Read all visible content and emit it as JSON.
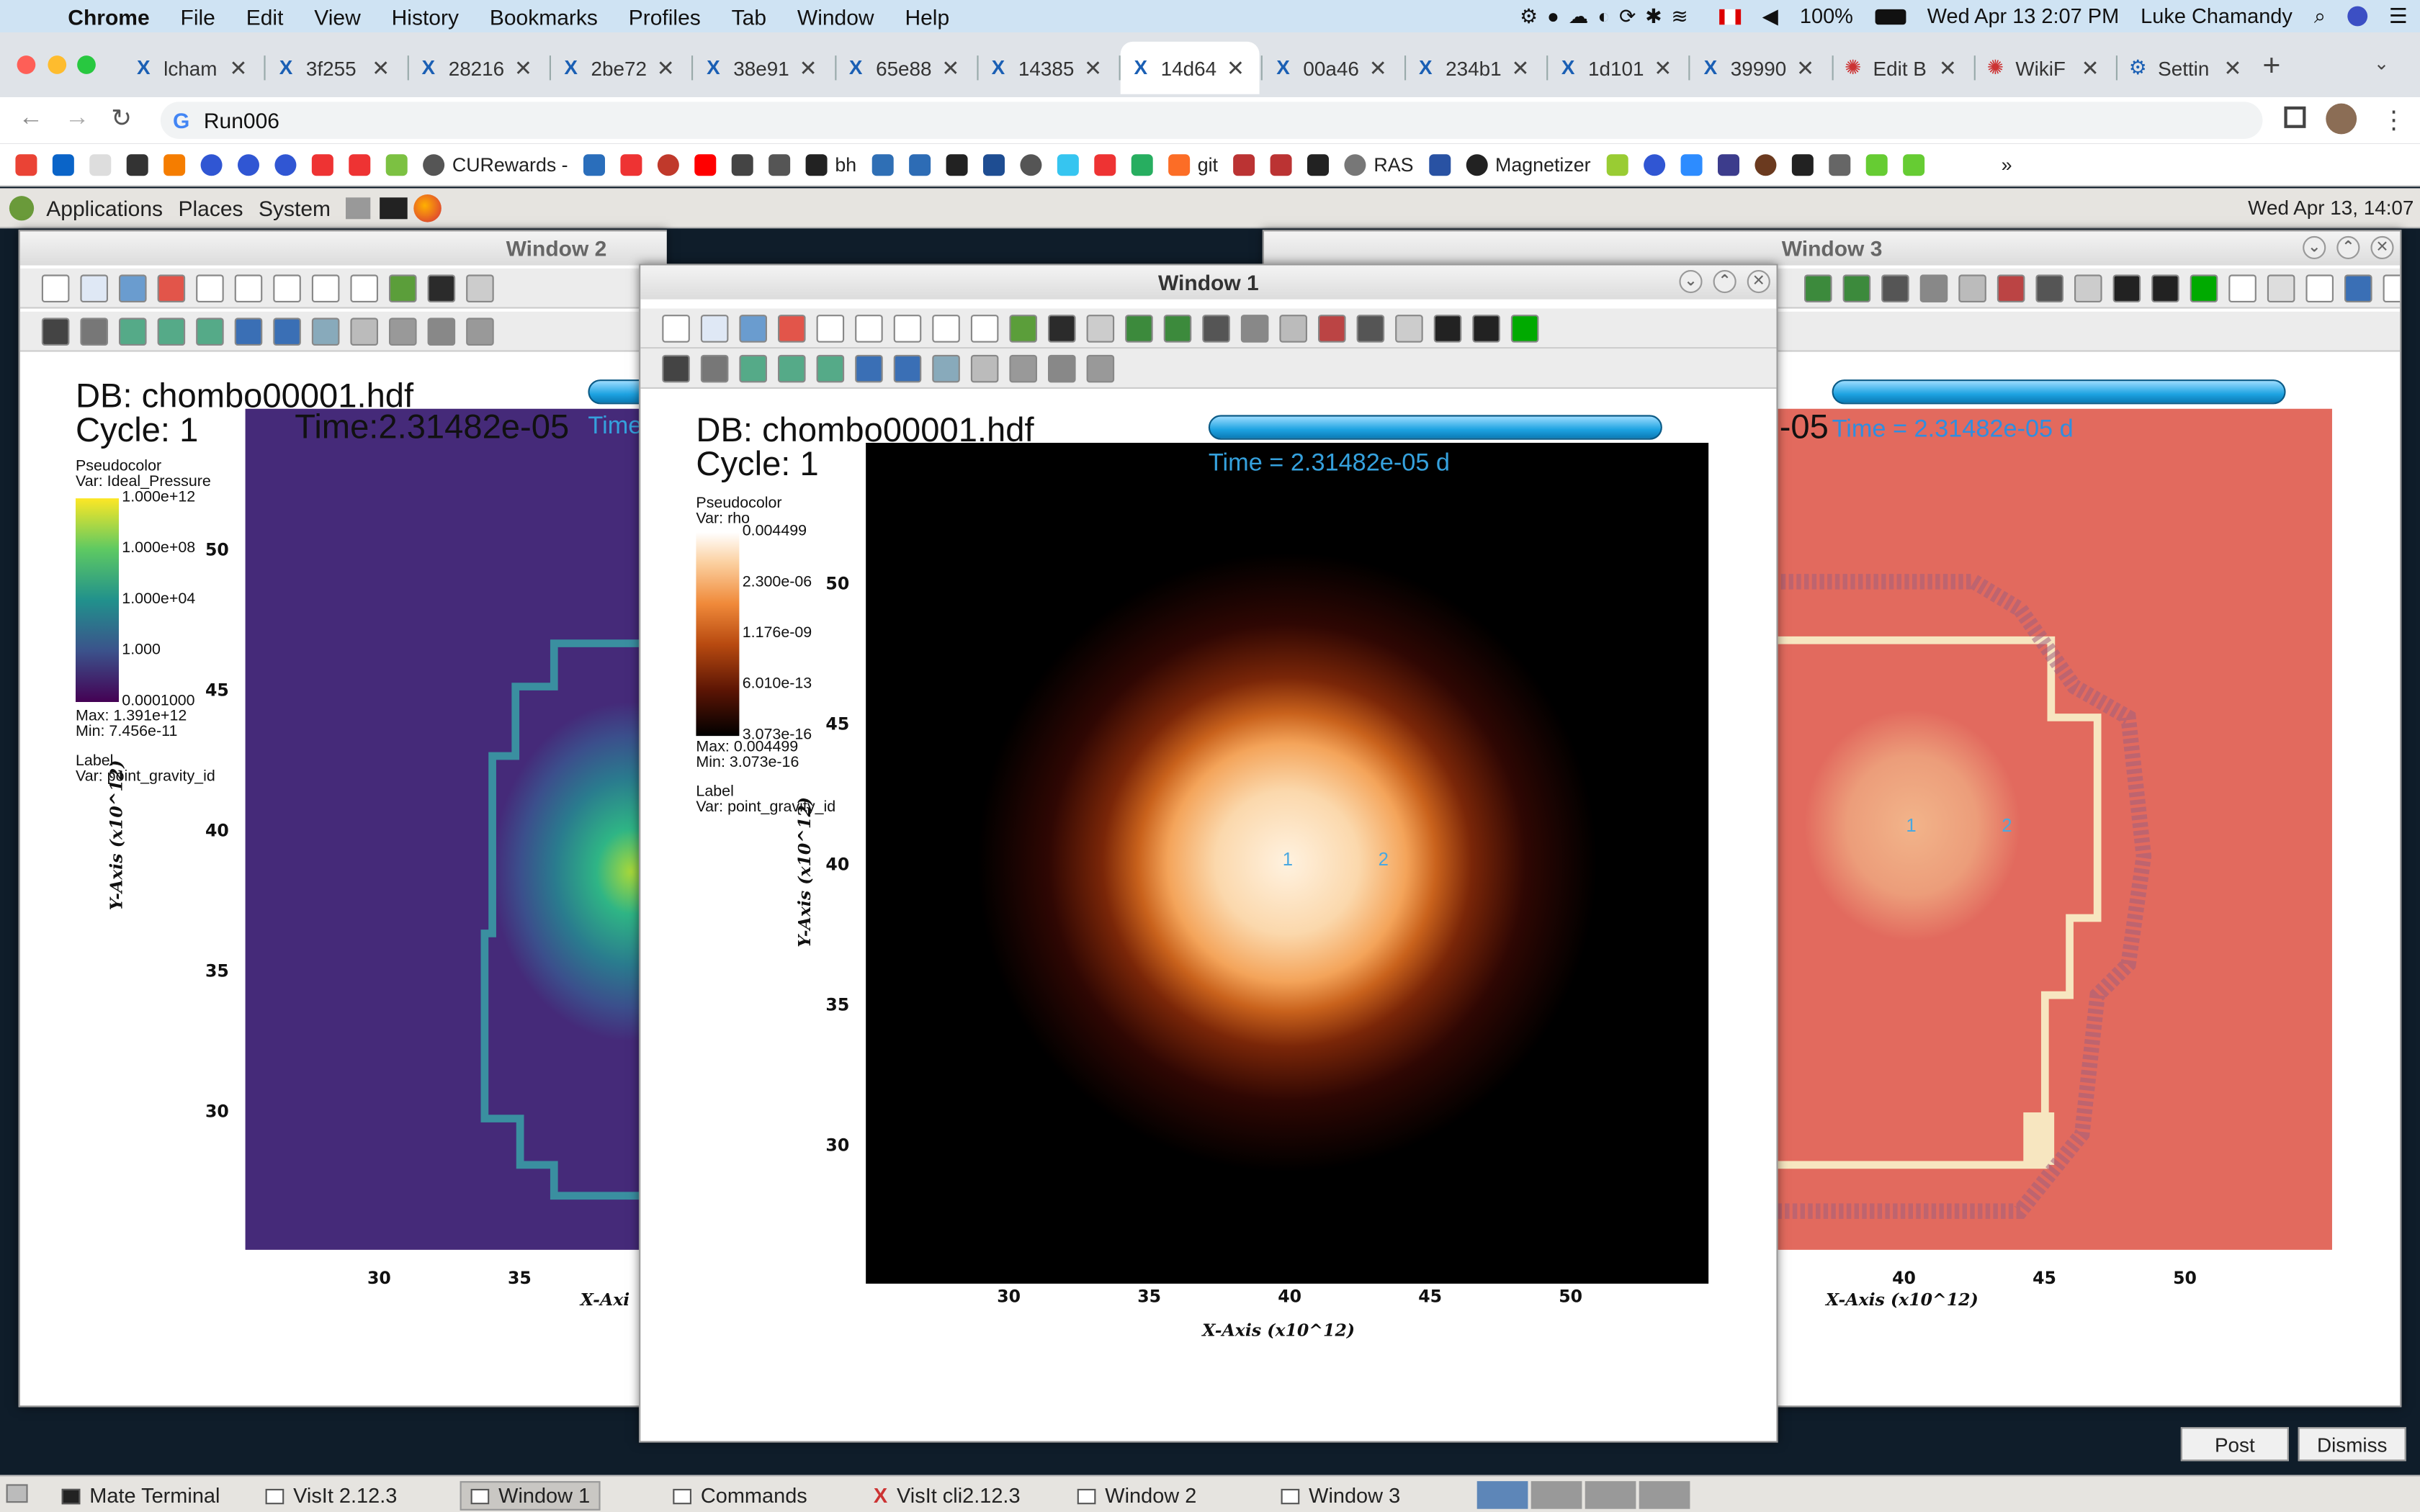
{
  "menubar": {
    "app": "Chrome",
    "items": [
      "File",
      "Edit",
      "View",
      "History",
      "Bookmarks",
      "Profiles",
      "Tab",
      "Window",
      "Help"
    ],
    "battery": "100%",
    "datetime": "Wed Apr 13  2:07 PM",
    "user": "Luke Chamandy"
  },
  "tabs": [
    {
      "label": "lcham",
      "active": false
    },
    {
      "label": "3f255",
      "active": false
    },
    {
      "label": "28216",
      "active": false
    },
    {
      "label": "2be72",
      "active": false
    },
    {
      "label": "38e91",
      "active": false
    },
    {
      "label": "65e88",
      "active": false
    },
    {
      "label": "14385",
      "active": false
    },
    {
      "label": "14d64",
      "active": true
    },
    {
      "label": "00a46",
      "active": false
    },
    {
      "label": "234b1",
      "active": false
    },
    {
      "label": "1d101",
      "active": false
    },
    {
      "label": "39990",
      "active": false
    },
    {
      "label": "Edit B",
      "active": false
    },
    {
      "label": "WikiF",
      "active": false
    },
    {
      "label": "Settin",
      "active": false
    }
  ],
  "address": {
    "url": "Run006"
  },
  "bookmarks": {
    "curewards": "CURewards -",
    "bh": "bh",
    "git": "git",
    "ras": "RAS",
    "magnetizer": "Magnetizer"
  },
  "gnome": {
    "applications": "Applications",
    "places": "Places",
    "system": "System",
    "clock": "Wed Apr 13, 14:07"
  },
  "taskbar": {
    "items": [
      "Mate Terminal",
      "VisIt 2.12.3",
      "Window 1",
      "Commands",
      "VisIt cli2.12.3",
      "Window 2",
      "Window 3"
    ]
  },
  "buttons": {
    "post": "Post",
    "dismiss": "Dismiss"
  },
  "window1": {
    "title": "Window 1",
    "db": "DB: chombo00001.hdf",
    "cycle": "Cycle: 1",
    "time": "Time = 2.31482e-05 d",
    "legend": {
      "plot": "Pseudocolor",
      "var": "Var: rho",
      "ticks": [
        "0.004499",
        "2.300e-06",
        "1.176e-09",
        "6.010e-13",
        "3.073e-16"
      ],
      "max": "Max:  0.004499",
      "min": "Min:  3.073e-16",
      "label": "Label",
      "labelvar": "Var: point_gravity_id"
    },
    "xaxis": {
      "title": "X-Axis  (x10^12)",
      "ticks": [
        "30",
        "35",
        "40",
        "45",
        "50"
      ]
    },
    "yaxis": {
      "title": "Y-Axis  (x10^12)",
      "ticks": [
        "50",
        "45",
        "40",
        "35",
        "30"
      ]
    },
    "points": [
      "1",
      "2"
    ]
  },
  "window2": {
    "title": "Window 2",
    "db": "DB: chombo00001.hdf",
    "cycle": "Cycle: 1",
    "time": "Time:2.31482e-05",
    "time2": "Time",
    "legend": {
      "plot": "Pseudocolor",
      "var": "Var: Ideal_Pressure",
      "ticks": [
        "1.000e+12",
        "1.000e+08",
        "1.000e+04",
        "1.000",
        "0.0001000"
      ],
      "max": "Max:  1.391e+12",
      "min": "Min:  7.456e-11",
      "label": "Label",
      "labelvar": "Var: point_gravity_id"
    },
    "xaxis": {
      "title": "X-Axi",
      "ticks": [
        "30",
        "35"
      ]
    },
    "yaxis": {
      "title": "Y-Axis  (x10^12)",
      "ticks": [
        "50",
        "45",
        "40",
        "35",
        "30"
      ]
    }
  },
  "window3": {
    "title": "Window 3",
    "timefrag": "-05",
    "time": "Time = 2.31482e-05 d",
    "xaxis": {
      "title": "X-Axis  (x10^12)",
      "ticks": [
        "40",
        "45",
        "50"
      ]
    },
    "points": [
      "1",
      "2"
    ]
  }
}
